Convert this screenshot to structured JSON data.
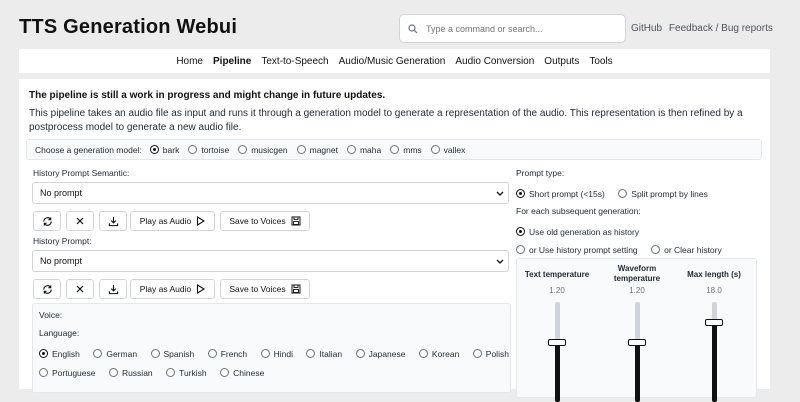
{
  "header": {
    "title": "TTS Generation Webui",
    "search_placeholder": "Type a command or search...",
    "links": [
      "GitHub",
      "Feedback / Bug reports"
    ]
  },
  "nav": {
    "items": [
      "Home",
      "Pipeline",
      "Text-to-Speech",
      "Audio/Music Generation",
      "Audio Conversion",
      "Outputs",
      "Tools"
    ],
    "active": "Pipeline"
  },
  "main": {
    "warning": "The pipeline is still a work in progress and might change in future updates.",
    "description": "This pipeline takes an audio file as input and runs it through a generation model to generate a representation of the audio. This representation is then refined by a postprocess model to generate a new audio file.",
    "model_label": "Choose a generation model:",
    "models": [
      "bark",
      "tortoise",
      "musicgen",
      "magnet",
      "maha",
      "mms",
      "vallex"
    ],
    "selected_model": "bark",
    "semantic_label": "History Prompt Semantic:",
    "semantic_value": "No prompt",
    "history_label": "History Prompt:",
    "history_value": "No prompt",
    "play_label": "Play as Audio",
    "save_label": "Save to Voices",
    "voice_label": "Voice:",
    "language_label": "Language:",
    "languages_row1": [
      "English",
      "German",
      "Spanish",
      "French",
      "Hindi",
      "Italian",
      "Japanese",
      "Korean",
      "Polish"
    ],
    "languages_row2": [
      "Portuguese",
      "Russian",
      "Turkish",
      "Chinese"
    ],
    "selected_language": "English"
  },
  "right": {
    "prompt_type_label": "Prompt type:",
    "prompt_types": [
      "Short prompt (<15s)",
      "Split prompt by lines"
    ],
    "selected_prompt_type": "Short prompt (<15s)",
    "subsequent_label": "For each subsequent generation:",
    "subsequent_options": [
      "Use old generation as history",
      "or Use history prompt setting",
      "or Clear history"
    ],
    "selected_subsequent": "Use old generation as history",
    "sliders": [
      {
        "label": "Text temperature",
        "value": "1.20",
        "fraction": 0.6
      },
      {
        "label": "Waveform temperature",
        "value": "1.20",
        "fraction": 0.6
      },
      {
        "label": "Max length (s)",
        "value": "18.0",
        "fraction": 0.8
      }
    ]
  }
}
